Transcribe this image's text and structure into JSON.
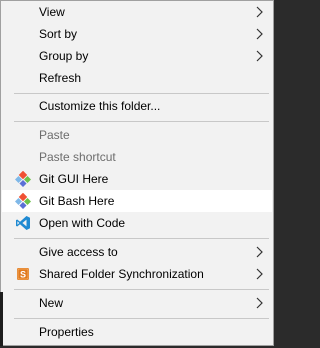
{
  "menu": {
    "items": [
      {
        "label": "View"
      },
      {
        "label": "Sort by"
      },
      {
        "label": "Group by"
      },
      {
        "label": "Refresh"
      },
      {
        "label": "Customize this folder..."
      },
      {
        "label": "Paste"
      },
      {
        "label": "Paste shortcut"
      },
      {
        "label": "Git GUI Here",
        "icon": "git-gui-icon"
      },
      {
        "label": "Git Bash Here",
        "icon": "git-bash-icon"
      },
      {
        "label": "Open with Code",
        "icon": "vscode-icon"
      },
      {
        "label": "Give access to"
      },
      {
        "label": "Shared Folder Synchronization",
        "icon": "shared-folder-sync-icon"
      },
      {
        "label": "New"
      },
      {
        "label": "Properties"
      }
    ]
  },
  "colors": {
    "menu_bg": "#f2f2f2",
    "hover_bg": "#ffffff",
    "disabled_text": "#6d6d6d",
    "separator": "#c8c8c8",
    "vscode_blue": "#1f8ad2",
    "sync_orange": "#e07a1f"
  }
}
